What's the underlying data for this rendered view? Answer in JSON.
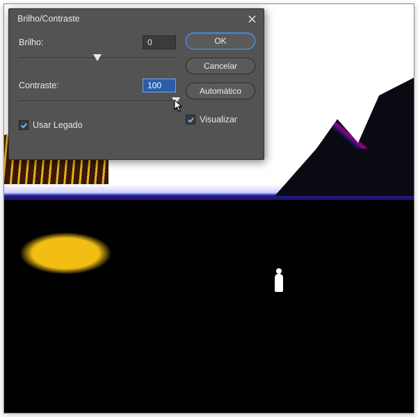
{
  "dialog": {
    "title": "Brilho/Contraste",
    "brightness": {
      "label": "Brilho:",
      "value": "0",
      "slider_percent": 50
    },
    "contrast": {
      "label": "Contraste:",
      "value": "100",
      "slider_percent": 100
    },
    "use_legacy": {
      "label": "Usar Legado",
      "checked": true
    },
    "preview": {
      "label": "Visualizar",
      "checked": true
    },
    "buttons": {
      "ok": "OK",
      "cancel": "Cancelar",
      "auto": "Automático"
    }
  }
}
